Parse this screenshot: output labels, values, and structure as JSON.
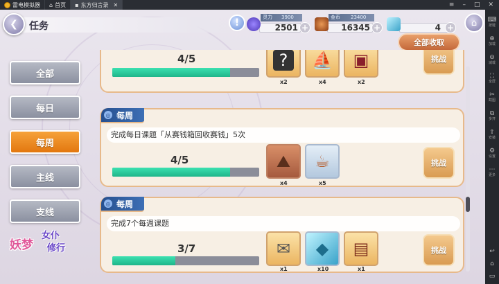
{
  "emulator": {
    "tabs": [
      {
        "label": "雷电模拟器"
      },
      {
        "label": "首页"
      },
      {
        "label": "东方归言录"
      }
    ],
    "sidebar": [
      {
        "glyph": "⌨",
        "label": "按键"
      },
      {
        "glyph": "⊕",
        "label": "加载"
      },
      {
        "glyph": "⊖",
        "label": "减载"
      },
      {
        "glyph": "⛶",
        "label": "全屏"
      },
      {
        "glyph": "✂",
        "label": "截图"
      },
      {
        "glyph": "⧉",
        "label": "多开"
      },
      {
        "glyph": "⇪",
        "label": "安装"
      },
      {
        "glyph": "⚙",
        "label": "设置"
      },
      {
        "glyph": "⋯",
        "label": "更多"
      }
    ]
  },
  "topbar": {
    "title": "任务",
    "resources": [
      {
        "name": "spirit",
        "tag": "灵力",
        "cap": "3900",
        "value": "2501",
        "color": "#6d58d6"
      },
      {
        "name": "money",
        "tag": "金币",
        "cap": "23400",
        "value": "16345",
        "color": "#c0622a"
      },
      {
        "name": "crystal",
        "tag": "",
        "cap": "",
        "value": "4",
        "color": "#58c6e0"
      }
    ]
  },
  "claim_all_label": "全部收取",
  "tabs": [
    {
      "label": "全部",
      "active": false
    },
    {
      "label": "每日",
      "active": false
    },
    {
      "label": "每周",
      "active": true
    },
    {
      "label": "主线",
      "active": false
    },
    {
      "label": "支线",
      "active": false
    }
  ],
  "logo": {
    "main": "妖梦",
    "sub": "女仆",
    "sub2": "修行"
  },
  "tasks": [
    {
      "category": "",
      "desc": "",
      "progress_text": "4/5",
      "progress": 0.8,
      "rewards": [
        {
          "icon": "mystery",
          "glyph": "?",
          "count": "x2",
          "style": "gold"
        },
        {
          "icon": "ship",
          "glyph": "⛵",
          "count": "x4",
          "style": "gold"
        },
        {
          "icon": "gift-box",
          "glyph": "▣",
          "count": "x2",
          "style": "gold"
        }
      ],
      "button": "挑战"
    },
    {
      "category": "每周",
      "desc": "完成每日课题「从赛钱箱回收赛钱」5次",
      "progress_text": "4/5",
      "progress": 0.8,
      "rewards": [
        {
          "icon": "rock",
          "glyph": "⛰",
          "count": "x4",
          "style": "brown"
        },
        {
          "icon": "tea-cup",
          "glyph": "☕",
          "count": "x5",
          "style": "blue"
        }
      ],
      "button": "挑战"
    },
    {
      "category": "每周",
      "desc": "完成7个每週课题",
      "progress_text": "3/7",
      "progress": 0.43,
      "rewards": [
        {
          "icon": "letters",
          "glyph": "✉",
          "count": "x1",
          "style": "gold"
        },
        {
          "icon": "ice-cube",
          "glyph": "◆",
          "count": "x10",
          "style": "blue"
        },
        {
          "icon": "bento",
          "glyph": "▤",
          "count": "x1",
          "style": "gold"
        }
      ],
      "button": "挑战"
    }
  ]
}
